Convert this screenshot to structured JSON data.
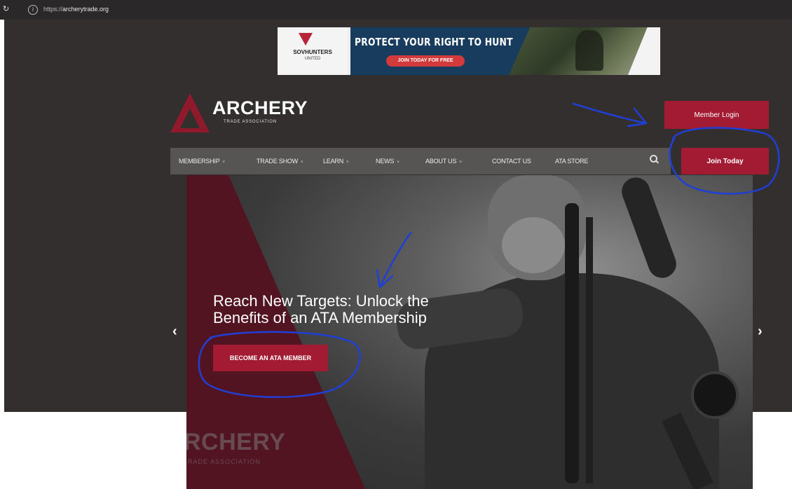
{
  "browser": {
    "url_scheme": "https://",
    "url_host": "archerytrade.org"
  },
  "banner": {
    "brand": "SOVHUNTERS",
    "brand_sub": "UNITED",
    "headline": "PROTECT YOUR RIGHT TO HUNT",
    "cta": "JOIN TODAY FOR FREE"
  },
  "header": {
    "logo_name": "ARCHERY",
    "logo_sub": "TRADE ASSOCIATION",
    "member_login": "Member Login",
    "join_today": "Join Today"
  },
  "nav": {
    "items": [
      {
        "label": "MEMBERSHIP",
        "has_dropdown": true
      },
      {
        "label": "TRADE SHOW",
        "has_dropdown": true
      },
      {
        "label": "LEARN",
        "has_dropdown": true
      },
      {
        "label": "NEWS",
        "has_dropdown": true
      },
      {
        "label": "ABOUT US",
        "has_dropdown": true
      },
      {
        "label": "CONTACT US",
        "has_dropdown": false
      },
      {
        "label": "ATA STORE",
        "has_dropdown": false
      }
    ],
    "search_icon": "search-icon"
  },
  "hero": {
    "headline_line1": "Reach New Targets: Unlock the",
    "headline_line2": "Benefits of an ATA Membership",
    "cta": "BECOME AN ATA MEMBER",
    "watermark_name": "RCHERY",
    "watermark_sub": "RADE ASSOCIATION",
    "prev_arrow": "‹",
    "next_arrow": "›"
  },
  "colors": {
    "page_bg": "#332f2f",
    "brand_red": "#a31a33",
    "nav_bg": "#575454",
    "annotation_blue": "#1f3fd6"
  }
}
